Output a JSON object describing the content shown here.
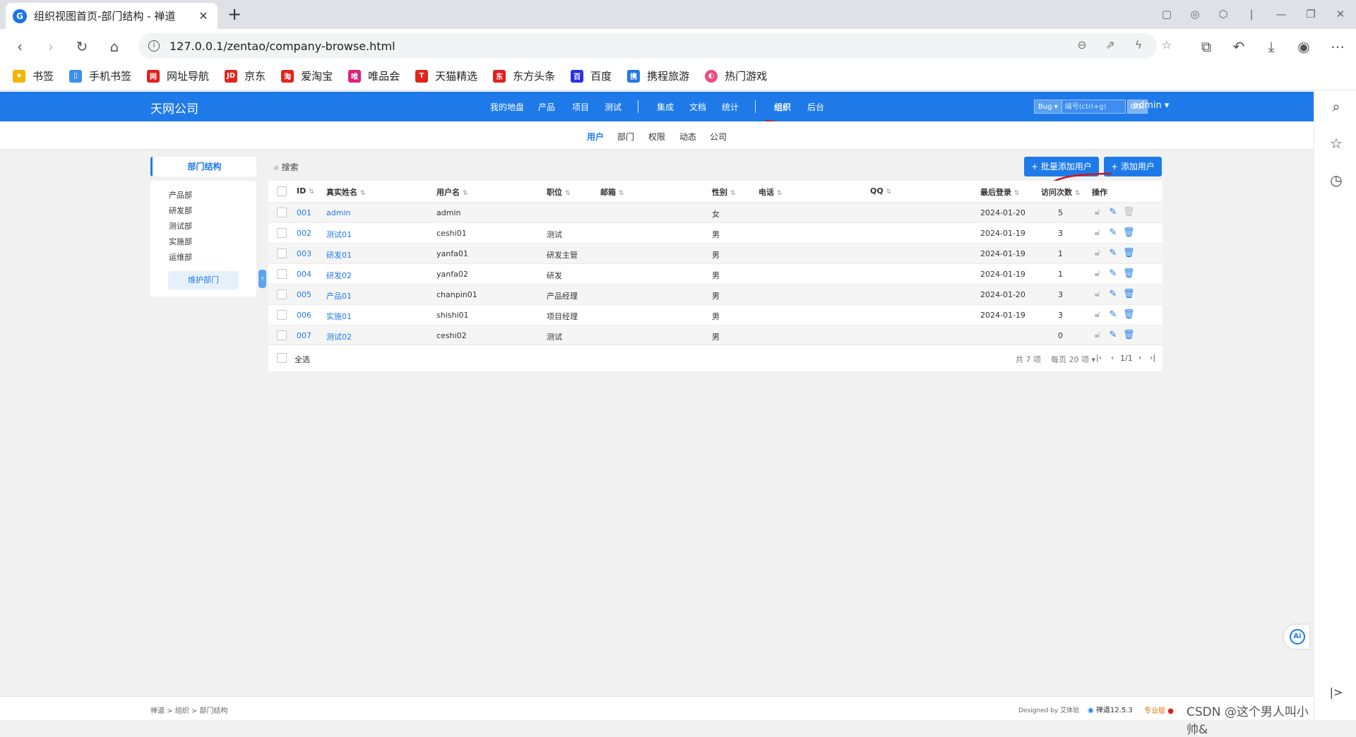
{
  "browser": {
    "tab_title": "组织视图首页-部门结构 - 禅道",
    "tab_close": "✕",
    "new_tab": "+",
    "url": "127.0.0.1/zentao/company-browse.html",
    "bookmarks": [
      {
        "label": "书签",
        "icon": "star-icon",
        "color": "#f5b400"
      },
      {
        "label": "手机书签",
        "icon": "phone-icon",
        "color": "#3d8fea"
      },
      {
        "label": "网址导航",
        "icon": "nav-icon",
        "color": "#e02020"
      },
      {
        "label": "京东",
        "icon": "jd-icon",
        "color": "#e1251b"
      },
      {
        "label": "爱淘宝",
        "icon": "taobao-icon",
        "color": "#e1251b"
      },
      {
        "label": "唯品会",
        "icon": "vip-icon",
        "color": "#e0227a"
      },
      {
        "label": "天猫精选",
        "icon": "tmall-icon",
        "color": "#e1251b"
      },
      {
        "label": "东方头条",
        "icon": "toutiao-icon",
        "color": "#e02020"
      },
      {
        "label": "百度",
        "icon": "baidu-icon",
        "color": "#2932e1"
      },
      {
        "label": "携程旅游",
        "icon": "ctrip-icon",
        "color": "#2577e3"
      },
      {
        "label": "热门游戏",
        "icon": "game-icon",
        "color": "#f04a7b"
      }
    ]
  },
  "app": {
    "company": "天网公司",
    "nav": [
      "我的地盘",
      "产品",
      "项目",
      "测试",
      "集成",
      "文档",
      "统计",
      "组织",
      "后台"
    ],
    "active_nav": "组织",
    "search": {
      "type": "Bug",
      "placeholder": "编号(ctrl+g)",
      "go": "GO!"
    },
    "user": "admin",
    "subnav": [
      "用户",
      "部门",
      "权限",
      "动态",
      "公司"
    ],
    "active_subnav": "用户",
    "accent": "#1e7ae9"
  },
  "sidebar": {
    "title": "部门结构",
    "departments": [
      "产品部",
      "研发部",
      "测试部",
      "实施部",
      "运维部"
    ],
    "maintain_button": "维护部门"
  },
  "toolbar": {
    "search": "搜索",
    "batch_add": "批量添加用户",
    "add": "添加用户"
  },
  "table": {
    "headers": [
      "ID",
      "真实姓名",
      "用户名",
      "职位",
      "邮箱",
      "性别",
      "电话",
      "QQ",
      "最后登录",
      "访问次数",
      "操作"
    ],
    "rows": [
      {
        "id": "001",
        "realname": "admin",
        "account": "admin",
        "role": "",
        "email": "",
        "gender": "女",
        "phone": "",
        "qq": "",
        "last": "2024-01-20",
        "visits": "5"
      },
      {
        "id": "002",
        "realname": "测试01",
        "account": "ceshi01",
        "role": "测试",
        "email": "",
        "gender": "男",
        "phone": "",
        "qq": "",
        "last": "2024-01-19",
        "visits": "3"
      },
      {
        "id": "003",
        "realname": "研发01",
        "account": "yanfa01",
        "role": "研发主管",
        "email": "",
        "gender": "男",
        "phone": "",
        "qq": "",
        "last": "2024-01-19",
        "visits": "1"
      },
      {
        "id": "004",
        "realname": "研发02",
        "account": "yanfa02",
        "role": "研发",
        "email": "",
        "gender": "男",
        "phone": "",
        "qq": "",
        "last": "2024-01-19",
        "visits": "1"
      },
      {
        "id": "005",
        "realname": "产品01",
        "account": "chanpin01",
        "role": "产品经理",
        "email": "",
        "gender": "男",
        "phone": "",
        "qq": "",
        "last": "2024-01-20",
        "visits": "3"
      },
      {
        "id": "006",
        "realname": "实施01",
        "account": "shishi01",
        "role": "项目经理",
        "email": "",
        "gender": "男",
        "phone": "",
        "qq": "",
        "last": "2024-01-19",
        "visits": "3"
      },
      {
        "id": "007",
        "realname": "测试02",
        "account": "ceshi02",
        "role": "测试",
        "email": "",
        "gender": "男",
        "phone": "",
        "qq": "",
        "last": "",
        "visits": "0"
      }
    ],
    "select_all": "全选",
    "total": "共 7 项",
    "per_page": "每页 20 项",
    "page": "1/1"
  },
  "footer": {
    "breadcrumb": [
      "禅道",
      "组织",
      "部门结构"
    ],
    "designed_by": "Designed by 艾体验",
    "version": "禅道12.5.3",
    "edition": "专业版",
    "watermark": "CSDN @这个男人叫小帅&"
  }
}
